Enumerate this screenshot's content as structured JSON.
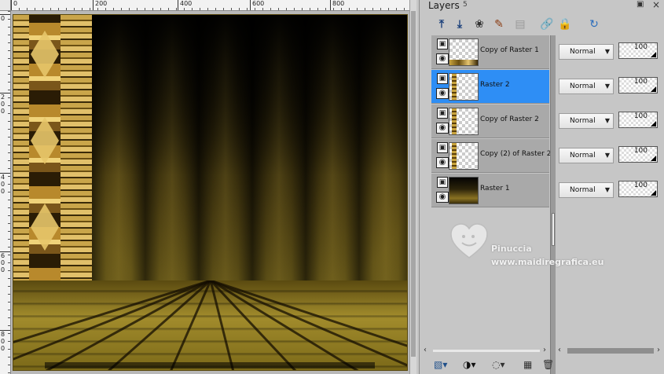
{
  "rulers": {
    "top_labels": [
      "0",
      "200",
      "400",
      "600",
      "800"
    ],
    "left_labels": [
      "0",
      "2\n0\n0",
      "4\n0\n0",
      "6\n0\n0",
      "8\n0\n0"
    ]
  },
  "palette": {
    "title": "Layers",
    "count": "5",
    "pin_glyph": "▣",
    "close_glyph": "×"
  },
  "toolbar": {
    "icons": [
      "move-layer-up-icon",
      "move-layer-down-icon",
      "new-layer-icon",
      "new-adjustment-layer-icon",
      "delete-layer-icon",
      "link-icon",
      "lock-icon",
      "refresh-icon"
    ]
  },
  "layers": [
    {
      "name": "Copy of Raster 1",
      "blend": "Normal",
      "opacity": "100",
      "thumb": "bottom-strip",
      "selected": false
    },
    {
      "name": "Raster 2",
      "blend": "Normal",
      "opacity": "100",
      "thumb": "left-strip",
      "selected": true
    },
    {
      "name": "Copy of Raster 2",
      "blend": "Normal",
      "opacity": "100",
      "thumb": "left-strip",
      "selected": false
    },
    {
      "name": "Copy (2) of Raster 2",
      "blend": "Normal",
      "opacity": "100",
      "thumb": "left-strip",
      "selected": false
    },
    {
      "name": "Raster 1",
      "blend": "Normal",
      "opacity": "100",
      "thumb": "full",
      "selected": false
    }
  ],
  "watermark": {
    "name": "Pinuccia",
    "url": "www.maidiregrafica.eu"
  },
  "colors": {
    "selection": "#2e8ef5",
    "panel": "#c6c6c6",
    "row": "#a9a9a9"
  }
}
